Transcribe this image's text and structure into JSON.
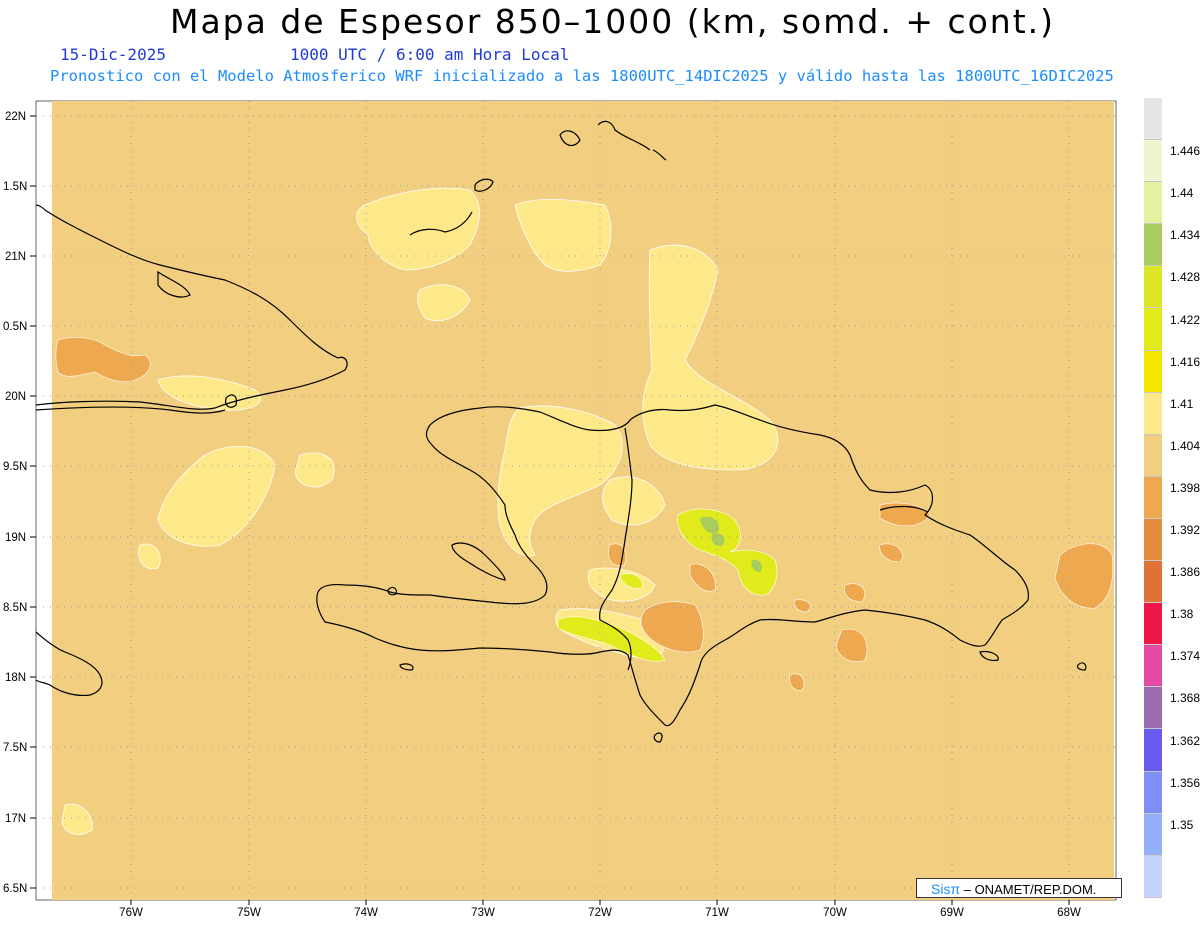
{
  "header": {
    "title": "Mapa de Espesor 850–1000 (km, somd. + cont.)",
    "date": "15-Dic-2025",
    "time": "1000 UTC / 6:00 am Hora Local",
    "description": "Pronostico con el Modelo Atmosferico WRF inicializado a las 1800UTC_14DIC2025 y válido hasta las  1800UTC_16DIC2025"
  },
  "map": {
    "base_fill_color": "#f2ce80",
    "coastline_color": "#000000",
    "grid_color": "#9a9aa8",
    "lat_labels": [
      "22N",
      "1.5N",
      "21N",
      "0.5N",
      "20N",
      "9.5N",
      "19N",
      "8.5N",
      "18N",
      "7.5N",
      "17N",
      "6.5N"
    ],
    "lon_labels": [
      "76W",
      "75W",
      "74W",
      "73W",
      "72W",
      "71W",
      "70W",
      "69W",
      "68W"
    ]
  },
  "colorbar": {
    "label_values": [
      "1.446",
      "1.44",
      "1.434",
      "1.428",
      "1.422",
      "1.416",
      "1.41",
      "1.404",
      "1.398",
      "1.392",
      "1.386",
      "1.38",
      "1.374",
      "1.368",
      "1.362",
      "1.356",
      "1.35"
    ],
    "colors": [
      "#e6e6e6",
      "#f1f5cf",
      "#e2f2a0",
      "#a8cc5e",
      "#dbe627",
      "#e1ea1a",
      "#f4e600",
      "#fde88a",
      "#f2ce80",
      "#eea850",
      "#e58c3e",
      "#df7335",
      "#ef1747",
      "#e34aa6",
      "#9c6cae",
      "#6a5bf0",
      "#7f8ff7",
      "#93b0f9",
      "#c5d2fb"
    ]
  },
  "credit": {
    "brand": "Sisπ",
    "org": " – ONAMET/REP.DOM."
  }
}
